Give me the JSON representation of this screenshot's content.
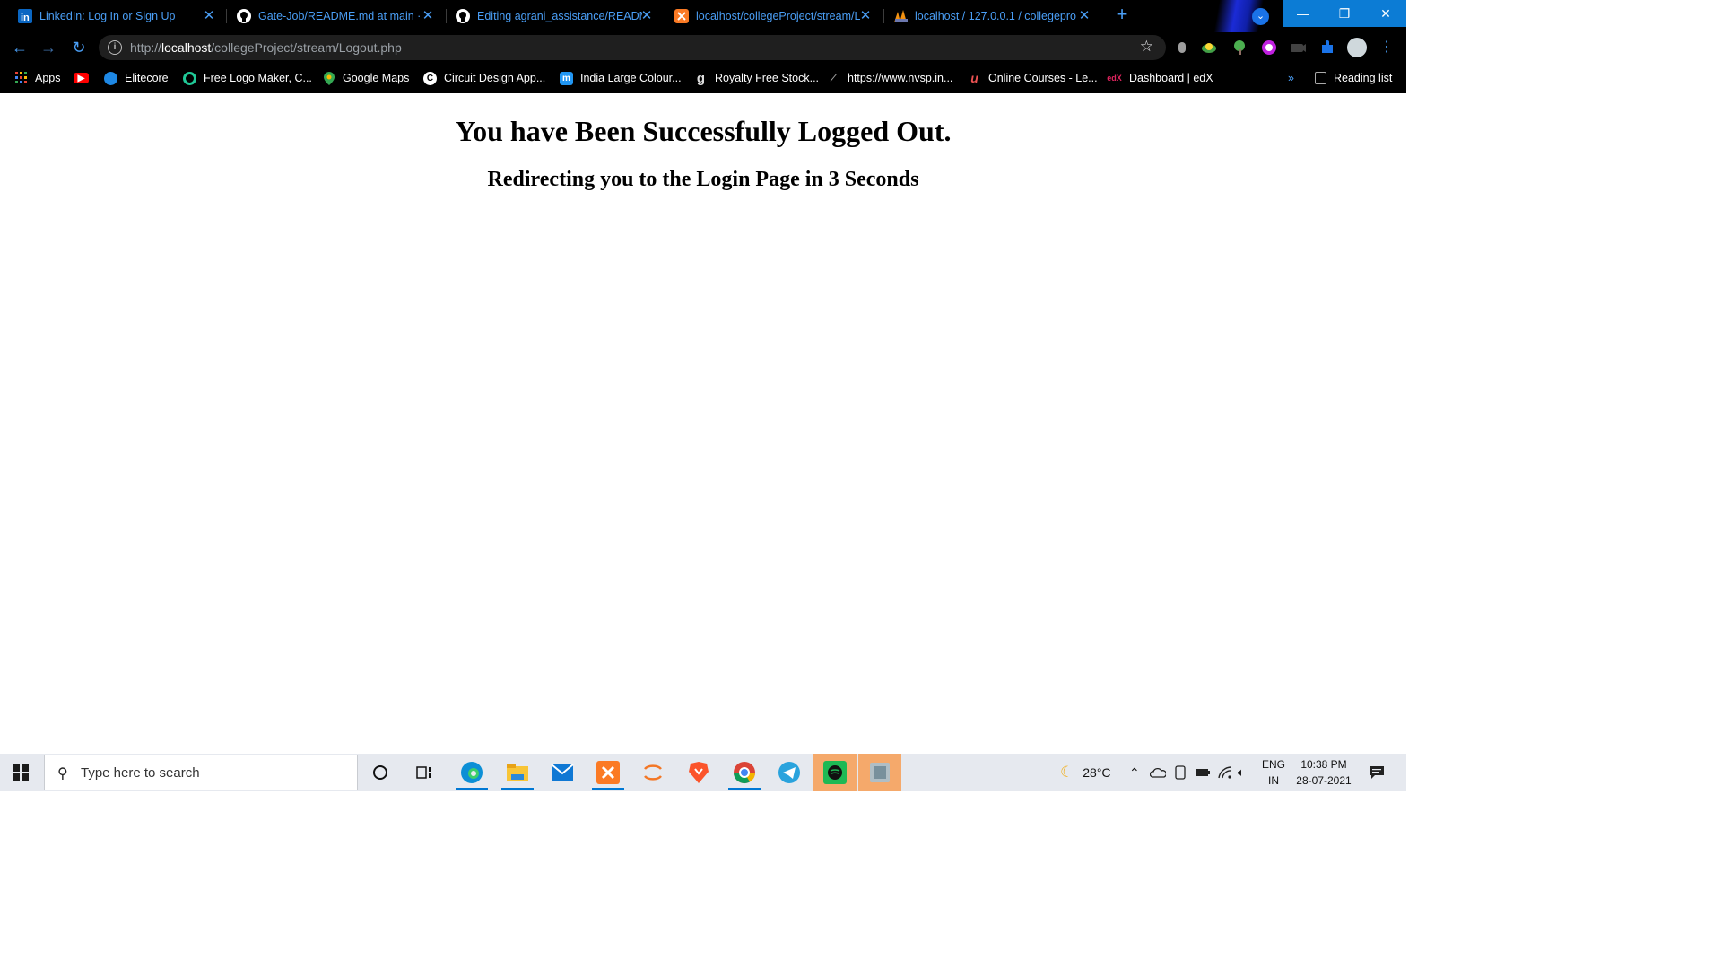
{
  "browser": {
    "tabs": [
      {
        "title": "LinkedIn: Log In or Sign Up",
        "icon": "linkedin-icon",
        "active": false
      },
      {
        "title": "Gate-Job/README.md at main · ",
        "icon": "github-icon",
        "active": false
      },
      {
        "title": "Editing agrani_assistance/READM",
        "icon": "github-icon",
        "active": false
      },
      {
        "title": "localhost/collegeProject/stream/L",
        "icon": "xampp-icon",
        "active": false
      },
      {
        "title": "localhost / 127.0.0.1 / collegepro",
        "icon": "phpmyadmin-icon",
        "active": true
      }
    ],
    "new_tab_symbol": "+",
    "close_symbol": "✕",
    "window_controls": {
      "minimize": "—",
      "maximize": "❐",
      "close": "✕"
    },
    "address": {
      "scheme": "http://",
      "host": "localhost",
      "path": "/collegeProject/stream/Logout.php"
    },
    "bookmarks": [
      {
        "label": "Apps",
        "icon": "apps-grid-icon"
      },
      {
        "label": "",
        "icon": "youtube-icon"
      },
      {
        "label": "Elitecore",
        "icon": "globe-icon"
      },
      {
        "label": "Free Logo Maker, C...",
        "icon": "logo-maker-icon"
      },
      {
        "label": "Google Maps",
        "icon": "maps-pin-icon"
      },
      {
        "label": "Circuit Design App...",
        "icon": "circuit-icon"
      },
      {
        "label": "India Large Colour...",
        "icon": "m-icon"
      },
      {
        "label": "Royalty Free Stock...",
        "icon": "g-icon"
      },
      {
        "label": "https://www.nvsp.in...",
        "icon": "nvsp-icon"
      },
      {
        "label": "Online Courses - Le...",
        "icon": "udemy-icon"
      },
      {
        "label": "Dashboard | edX",
        "icon": "edx-icon"
      }
    ],
    "bookmarks_overflow": "»",
    "reading_list": "Reading list"
  },
  "page": {
    "heading": "You have Been Successfully Logged Out.",
    "subheading": "Redirecting you to the Login Page in 3 Seconds"
  },
  "taskbar": {
    "search_placeholder": "Type here to search",
    "weather": "28°C",
    "language": "ENG",
    "region": "IN",
    "time": "10:38 PM",
    "date": "28-07-2021"
  },
  "colors": {
    "tab_text": "#4a9ef5",
    "chrome_bg": "#000000",
    "accent": "#0c7cd5"
  }
}
